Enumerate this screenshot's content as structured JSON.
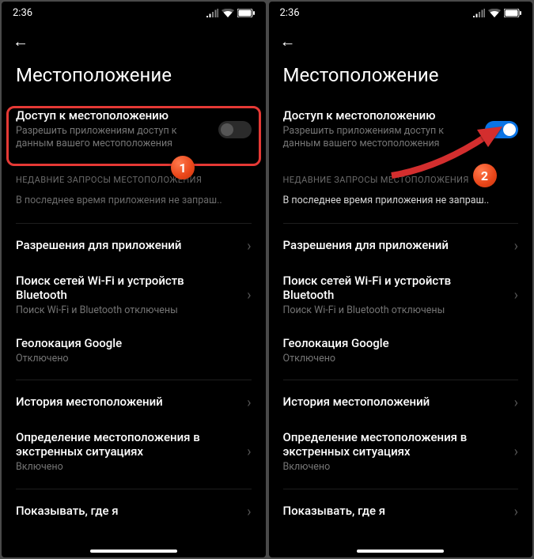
{
  "status": {
    "time": "2:36"
  },
  "page": {
    "title": "Местоположение"
  },
  "location_access": {
    "title": "Доступ к местоположению",
    "subtitle": "Разрешить приложениям доступ к данным вашего местоположения"
  },
  "recent": {
    "header": "НЕДАВНИЕ ЗАПРОСЫ МЕСТОПОЛОЖЕНИЯ",
    "empty_text": "В последнее время приложения не запраш.."
  },
  "items": {
    "app_permissions": {
      "title": "Разрешения для приложений"
    },
    "wifi_bt": {
      "title": "Поиск сетей Wi-Fi и устройств Bluetooth",
      "subtitle": "Поиск Wi-Fi и Bluetooth отключены"
    },
    "google_location": {
      "title": "Геолокация Google",
      "subtitle": "Отключено"
    },
    "history": {
      "title": "История местоположений"
    },
    "emergency": {
      "title": "Определение местоположения в экстренных ситуациях",
      "subtitle": "Включено"
    },
    "show_where": {
      "title": "Показывать, где я"
    }
  },
  "badges": {
    "one": "1",
    "two": "2"
  }
}
